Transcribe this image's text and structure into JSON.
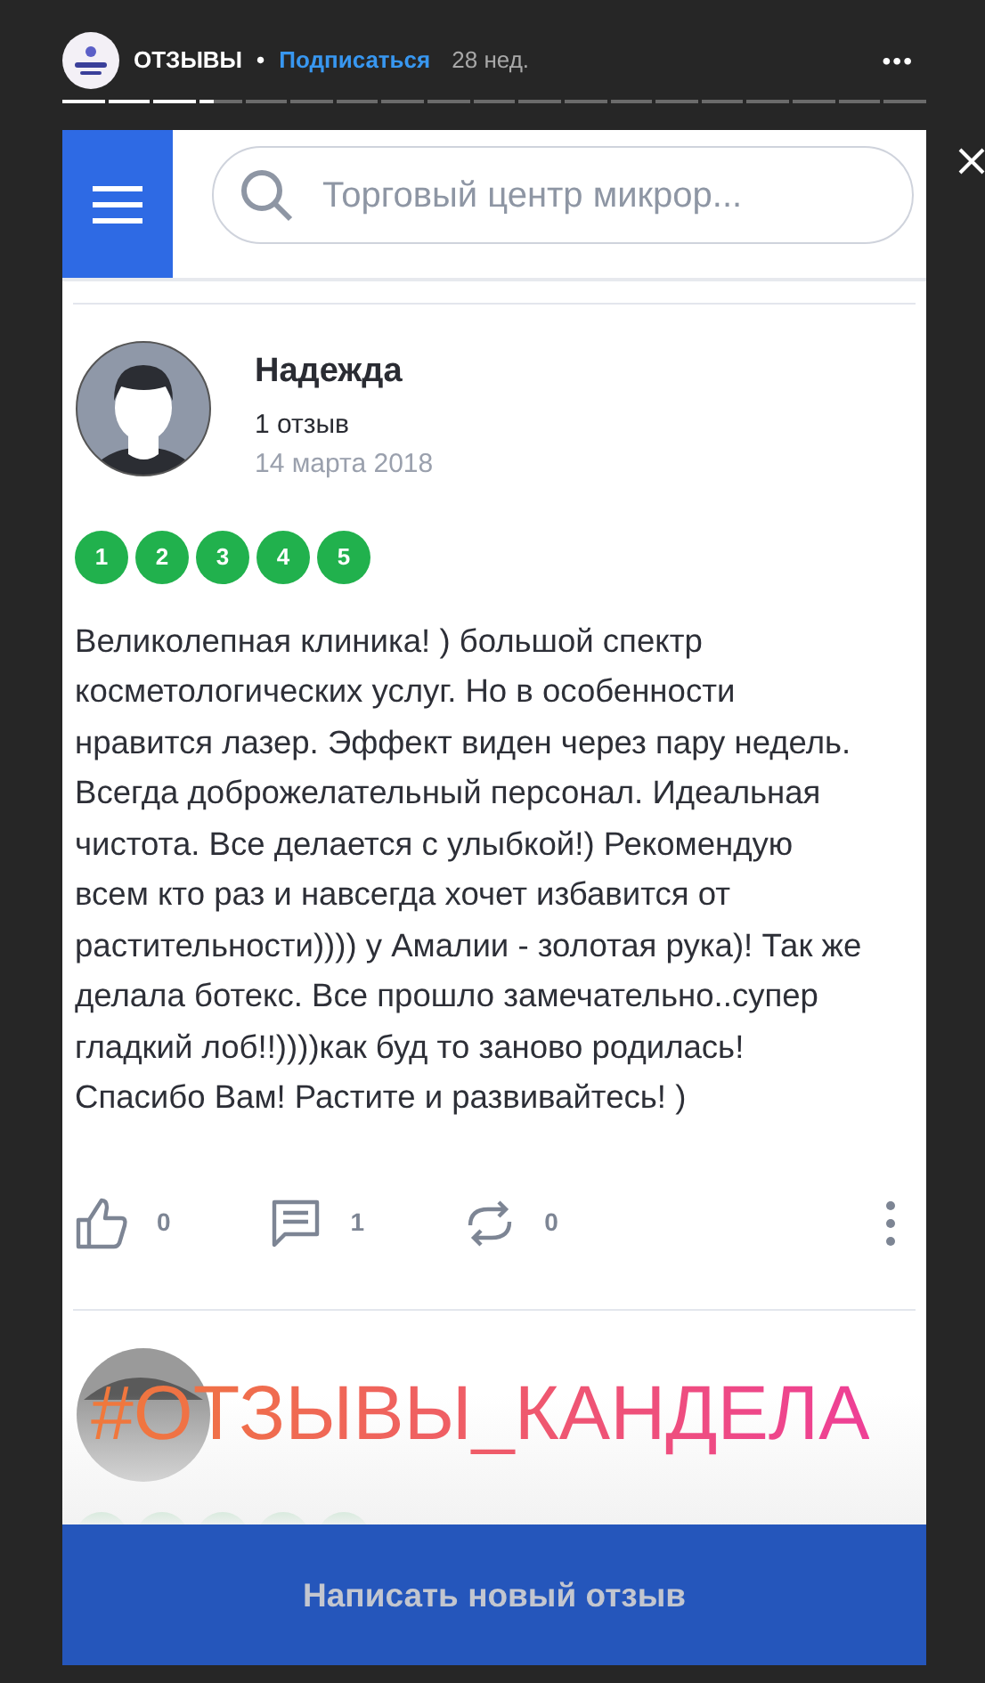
{
  "story_header": {
    "account": "ОТЗЫВЫ",
    "separator": "•",
    "follow": "Подписаться",
    "age": "28 нед.",
    "more": "•••"
  },
  "progress": [
    {
      "level": 1
    },
    {
      "level": 1
    },
    {
      "level": 1
    },
    {
      "level": 0.35
    },
    {
      "level": 0
    },
    {
      "level": 0
    },
    {
      "level": 0
    },
    {
      "level": 0
    },
    {
      "level": 0
    },
    {
      "level": 0
    },
    {
      "level": 0
    },
    {
      "level": 0
    },
    {
      "level": 0
    },
    {
      "level": 0
    },
    {
      "level": 0
    },
    {
      "level": 0
    },
    {
      "level": 0
    },
    {
      "level": 0
    },
    {
      "level": 0
    }
  ],
  "app_header": {
    "search": {
      "placeholder": "Торговый центр микрор..."
    }
  },
  "review": {
    "author": "Надежда",
    "count": "1 отзыв",
    "date": "14 марта 2018",
    "rating": [
      "1",
      "2",
      "3",
      "4",
      "5"
    ],
    "text": "Великолепная клиника! ) большой спектр косметологических услуг. Но в особенности нравится лазер. Эффект виден через пару недель. Всегда доброжелательный персонал. Идеальная чистота. Все делается с улыбкой!) Рекомендую всем кто раз и навсегда хочет избавится от растительности)))) у Амалии - золотая рука)! Так же делала ботекс. Все прошло замечательно..супер гладкий лоб!!))))как буд то заново родилась! Спасибо Вам! Растите и развивайтесь! )",
    "actions": [
      {
        "kind": "like",
        "count": "0"
      },
      {
        "kind": "comment",
        "count": "1"
      },
      {
        "kind": "repost",
        "count": "0"
      }
    ]
  },
  "hashtag": "#ОТЗЫВЫ_КАНДЕЛА",
  "write_button": "Написать новый отзыв"
}
